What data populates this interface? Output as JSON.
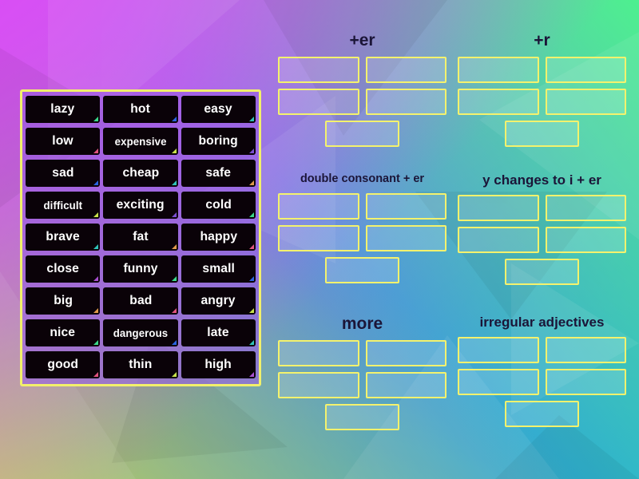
{
  "background": {
    "colors": {
      "top_left": "#d94ef5",
      "top_right": "#4ef08f",
      "bottom_left": "#b9cc5c",
      "bottom_right": "#29a8d8"
    }
  },
  "word_panel": {
    "border_color": "#f2f06a",
    "card_background": "#0a0208",
    "cards": [
      {
        "label": "lazy",
        "handle_color": "#3ad98a"
      },
      {
        "label": "hot",
        "handle_color": "#2a63e0"
      },
      {
        "label": "easy",
        "handle_color": "#2fc3b8"
      },
      {
        "label": "low",
        "handle_color": "#e0537e"
      },
      {
        "label": "expensive",
        "handle_color": "#c8e24a"
      },
      {
        "label": "boring",
        "handle_color": "#7a4fd0"
      },
      {
        "label": "sad",
        "handle_color": "#2a63e0"
      },
      {
        "label": "cheap",
        "handle_color": "#2fc3b8"
      },
      {
        "label": "safe",
        "handle_color": "#e09a4a"
      },
      {
        "label": "difficult",
        "handle_color": "#c8e24a"
      },
      {
        "label": "exciting",
        "handle_color": "#7a4fd0"
      },
      {
        "label": "cold",
        "handle_color": "#3ad98a"
      },
      {
        "label": "brave",
        "handle_color": "#2fc3b8"
      },
      {
        "label": "fat",
        "handle_color": "#e09a4a"
      },
      {
        "label": "happy",
        "handle_color": "#e0537e"
      },
      {
        "label": "close",
        "handle_color": "#a84fd0"
      },
      {
        "label": "funny",
        "handle_color": "#3ad98a"
      },
      {
        "label": "small",
        "handle_color": "#2a63e0"
      },
      {
        "label": "big",
        "handle_color": "#e09a4a"
      },
      {
        "label": "bad",
        "handle_color": "#e0537e"
      },
      {
        "label": "angry",
        "handle_color": "#c8e24a"
      },
      {
        "label": "nice",
        "handle_color": "#3ad98a"
      },
      {
        "label": "dangerous",
        "handle_color": "#2a63e0"
      },
      {
        "label": "late",
        "handle_color": "#2fc3b8"
      },
      {
        "label": "good",
        "handle_color": "#e0537e"
      },
      {
        "label": "thin",
        "handle_color": "#c8e24a"
      },
      {
        "label": "high",
        "handle_color": "#a84fd0"
      }
    ]
  },
  "groups": [
    {
      "title": "+er",
      "size": "t-big",
      "slots": 5
    },
    {
      "title": "+r",
      "size": "t-big",
      "slots": 5
    },
    {
      "title": "double consonant + er",
      "size": "t-sm",
      "slots": 5
    },
    {
      "title": "y changes to i + er",
      "size": "t-mid",
      "slots": 5
    },
    {
      "title": "more",
      "size": "t-big",
      "slots": 5
    },
    {
      "title": "irregular adjectives",
      "size": "t-mid",
      "slots": 5
    }
  ]
}
